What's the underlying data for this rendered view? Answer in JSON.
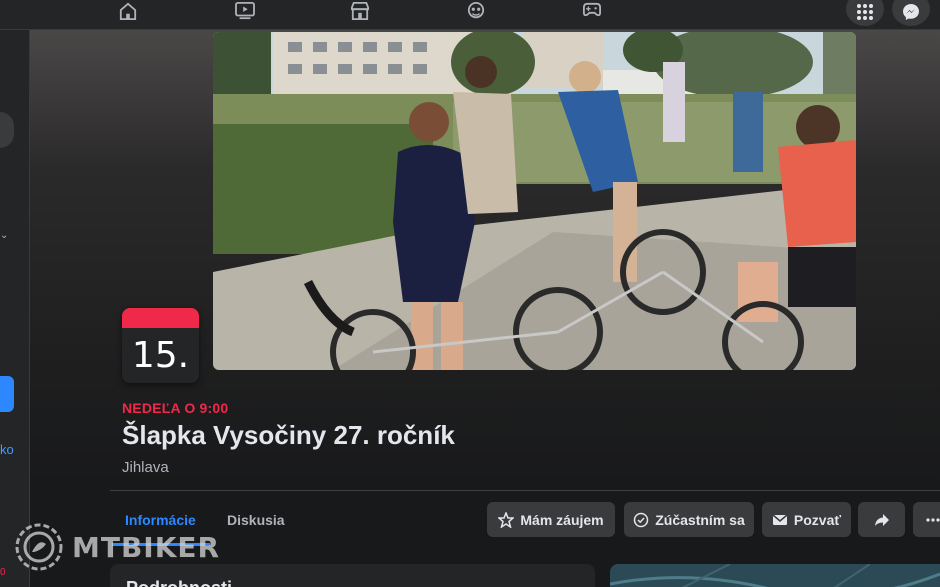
{
  "event": {
    "day": "15.",
    "when": "NEDEĽA O 9:00",
    "title": "Šlapka Vysočiny 27. ročník",
    "location": "Jihlava"
  },
  "tabs": [
    {
      "label": "Informácie",
      "active": true
    },
    {
      "label": "Diskusia",
      "active": false
    }
  ],
  "actions": {
    "interested": "Mám záujem",
    "going": "Zúčastním sa",
    "invite": "Pozvať"
  },
  "left_panel": {
    "partial_text": "ko",
    "partial_badge": "0"
  },
  "sections": {
    "details_title_partial": "Podrobnosti"
  },
  "watermark": "MTBIKER",
  "colors": {
    "accent": "#2d88ff",
    "date_red": "#f02849",
    "background": "#18191a",
    "surface": "#242526",
    "button": "#3a3b3c"
  },
  "icons": {
    "nav": [
      "home-icon",
      "watch-icon",
      "marketplace-icon",
      "groups-icon",
      "gaming-icon"
    ],
    "right": [
      "menu-grid-icon",
      "messenger-icon"
    ]
  }
}
